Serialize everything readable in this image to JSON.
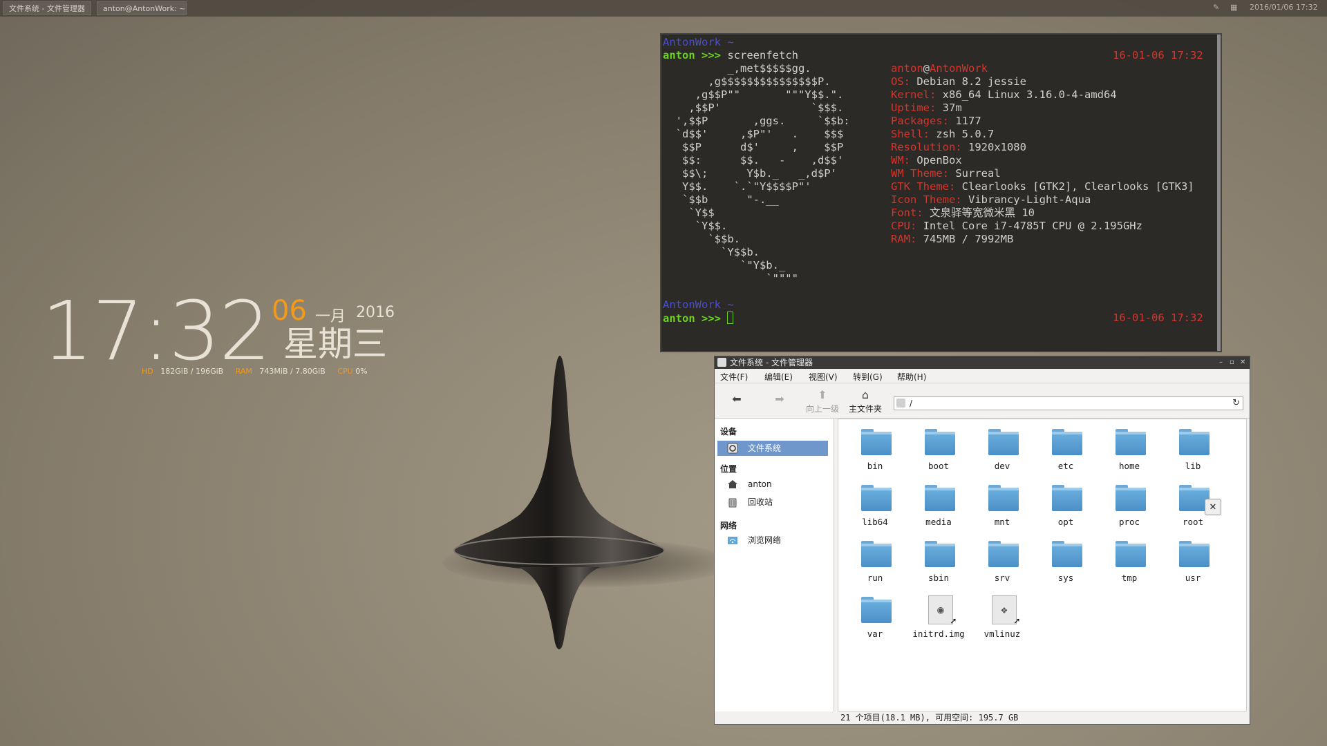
{
  "panel": {
    "tasks": [
      "文件系统 - 文件管理器",
      "anton@AntonWork: ~"
    ],
    "datetime": "2016/01/06 17:32"
  },
  "clock": {
    "time": "17:32",
    "day": "06",
    "month": "一月",
    "year": "2016",
    "weekday": "星期三",
    "hd_label": "HD",
    "hd_value": "182GiB / 196GiB",
    "ram_label": "RAM",
    "ram_value": "743MiB / 7.80GiB",
    "cpu_label": "CPU",
    "cpu_value": "0%"
  },
  "terminal": {
    "host1": "AntonWork ~",
    "user1": "anton >>>",
    "cmd1": " screenfetch",
    "time1": "16-01-06 17:32",
    "logo": [
      "          _,met$$$$$gg.",
      "       ,g$$$$$$$$$$$$$$$P.",
      "     ,g$$P\"\"       \"\"\"Y$$.\".",
      "    ,$$P'              `$$$.",
      "  ',$$P       ,ggs.     `$$b:",
      "  `d$$'     ,$P\"'   .    $$$",
      "   $$P      d$'     ,    $$P",
      "   $$:      $$.   -    ,d$$'",
      "   $$\\;      Y$b._   _,d$P'",
      "   Y$$.    `.`\"Y$$$$P\"'",
      "   `$$b      \"-.__",
      "    `Y$$",
      "     `Y$$.",
      "       `$$b.",
      "         `Y$$b.",
      "            `\"Y$b._",
      "                `\"\"\"\""
    ],
    "user_at": "anton",
    "at": "@",
    "hostname": "AntonWork",
    "info": [
      {
        "k": "OS:",
        "v": " Debian 8.2 jessie"
      },
      {
        "k": "Kernel:",
        "v": " x86_64 Linux 3.16.0-4-amd64"
      },
      {
        "k": "Uptime:",
        "v": " 37m"
      },
      {
        "k": "Packages:",
        "v": " 1177"
      },
      {
        "k": "Shell:",
        "v": " zsh 5.0.7"
      },
      {
        "k": "Resolution:",
        "v": " 1920x1080"
      },
      {
        "k": "WM:",
        "v": " OpenBox"
      },
      {
        "k": "WM Theme:",
        "v": " Surreal"
      },
      {
        "k": "GTK Theme:",
        "v": " Clearlooks [GTK2], Clearlooks [GTK3]"
      },
      {
        "k": "Icon Theme:",
        "v": " Vibrancy-Light-Aqua"
      },
      {
        "k": "Font:",
        "v": " 文泉驿等宽微米黑 10"
      },
      {
        "k": "CPU:",
        "v": " Intel Core i7-4785T CPU @ 2.195GHz"
      },
      {
        "k": "RAM:",
        "v": " 745MB / 7992MB"
      }
    ],
    "host2": "AntonWork ~",
    "user2": "anton >>>",
    "time2": "16-01-06 17:32"
  },
  "filemanager": {
    "title": "文件系统 - 文件管理器",
    "menu": [
      "文件(F)",
      "编辑(E)",
      "视图(V)",
      "转到(G)",
      "帮助(H)"
    ],
    "toolbar": {
      "up": "向上一级",
      "home": "主文件夹"
    },
    "address": "/",
    "sidebar": {
      "devices_header": "设备",
      "filesystem": "文件系统",
      "places_header": "位置",
      "home": "anton",
      "trash": "回收站",
      "network_header": "网络",
      "browse_network": "浏览网络"
    },
    "items": [
      "bin",
      "boot",
      "dev",
      "etc",
      "home",
      "lib",
      "lib64",
      "media",
      "mnt",
      "opt",
      "proc",
      "root",
      "run",
      "sbin",
      "srv",
      "sys",
      "tmp",
      "usr",
      "var",
      "initrd.img",
      "vmlinuz"
    ],
    "status": "21 个项目(18.1 MB), 可用空间: 195.7 GB"
  }
}
